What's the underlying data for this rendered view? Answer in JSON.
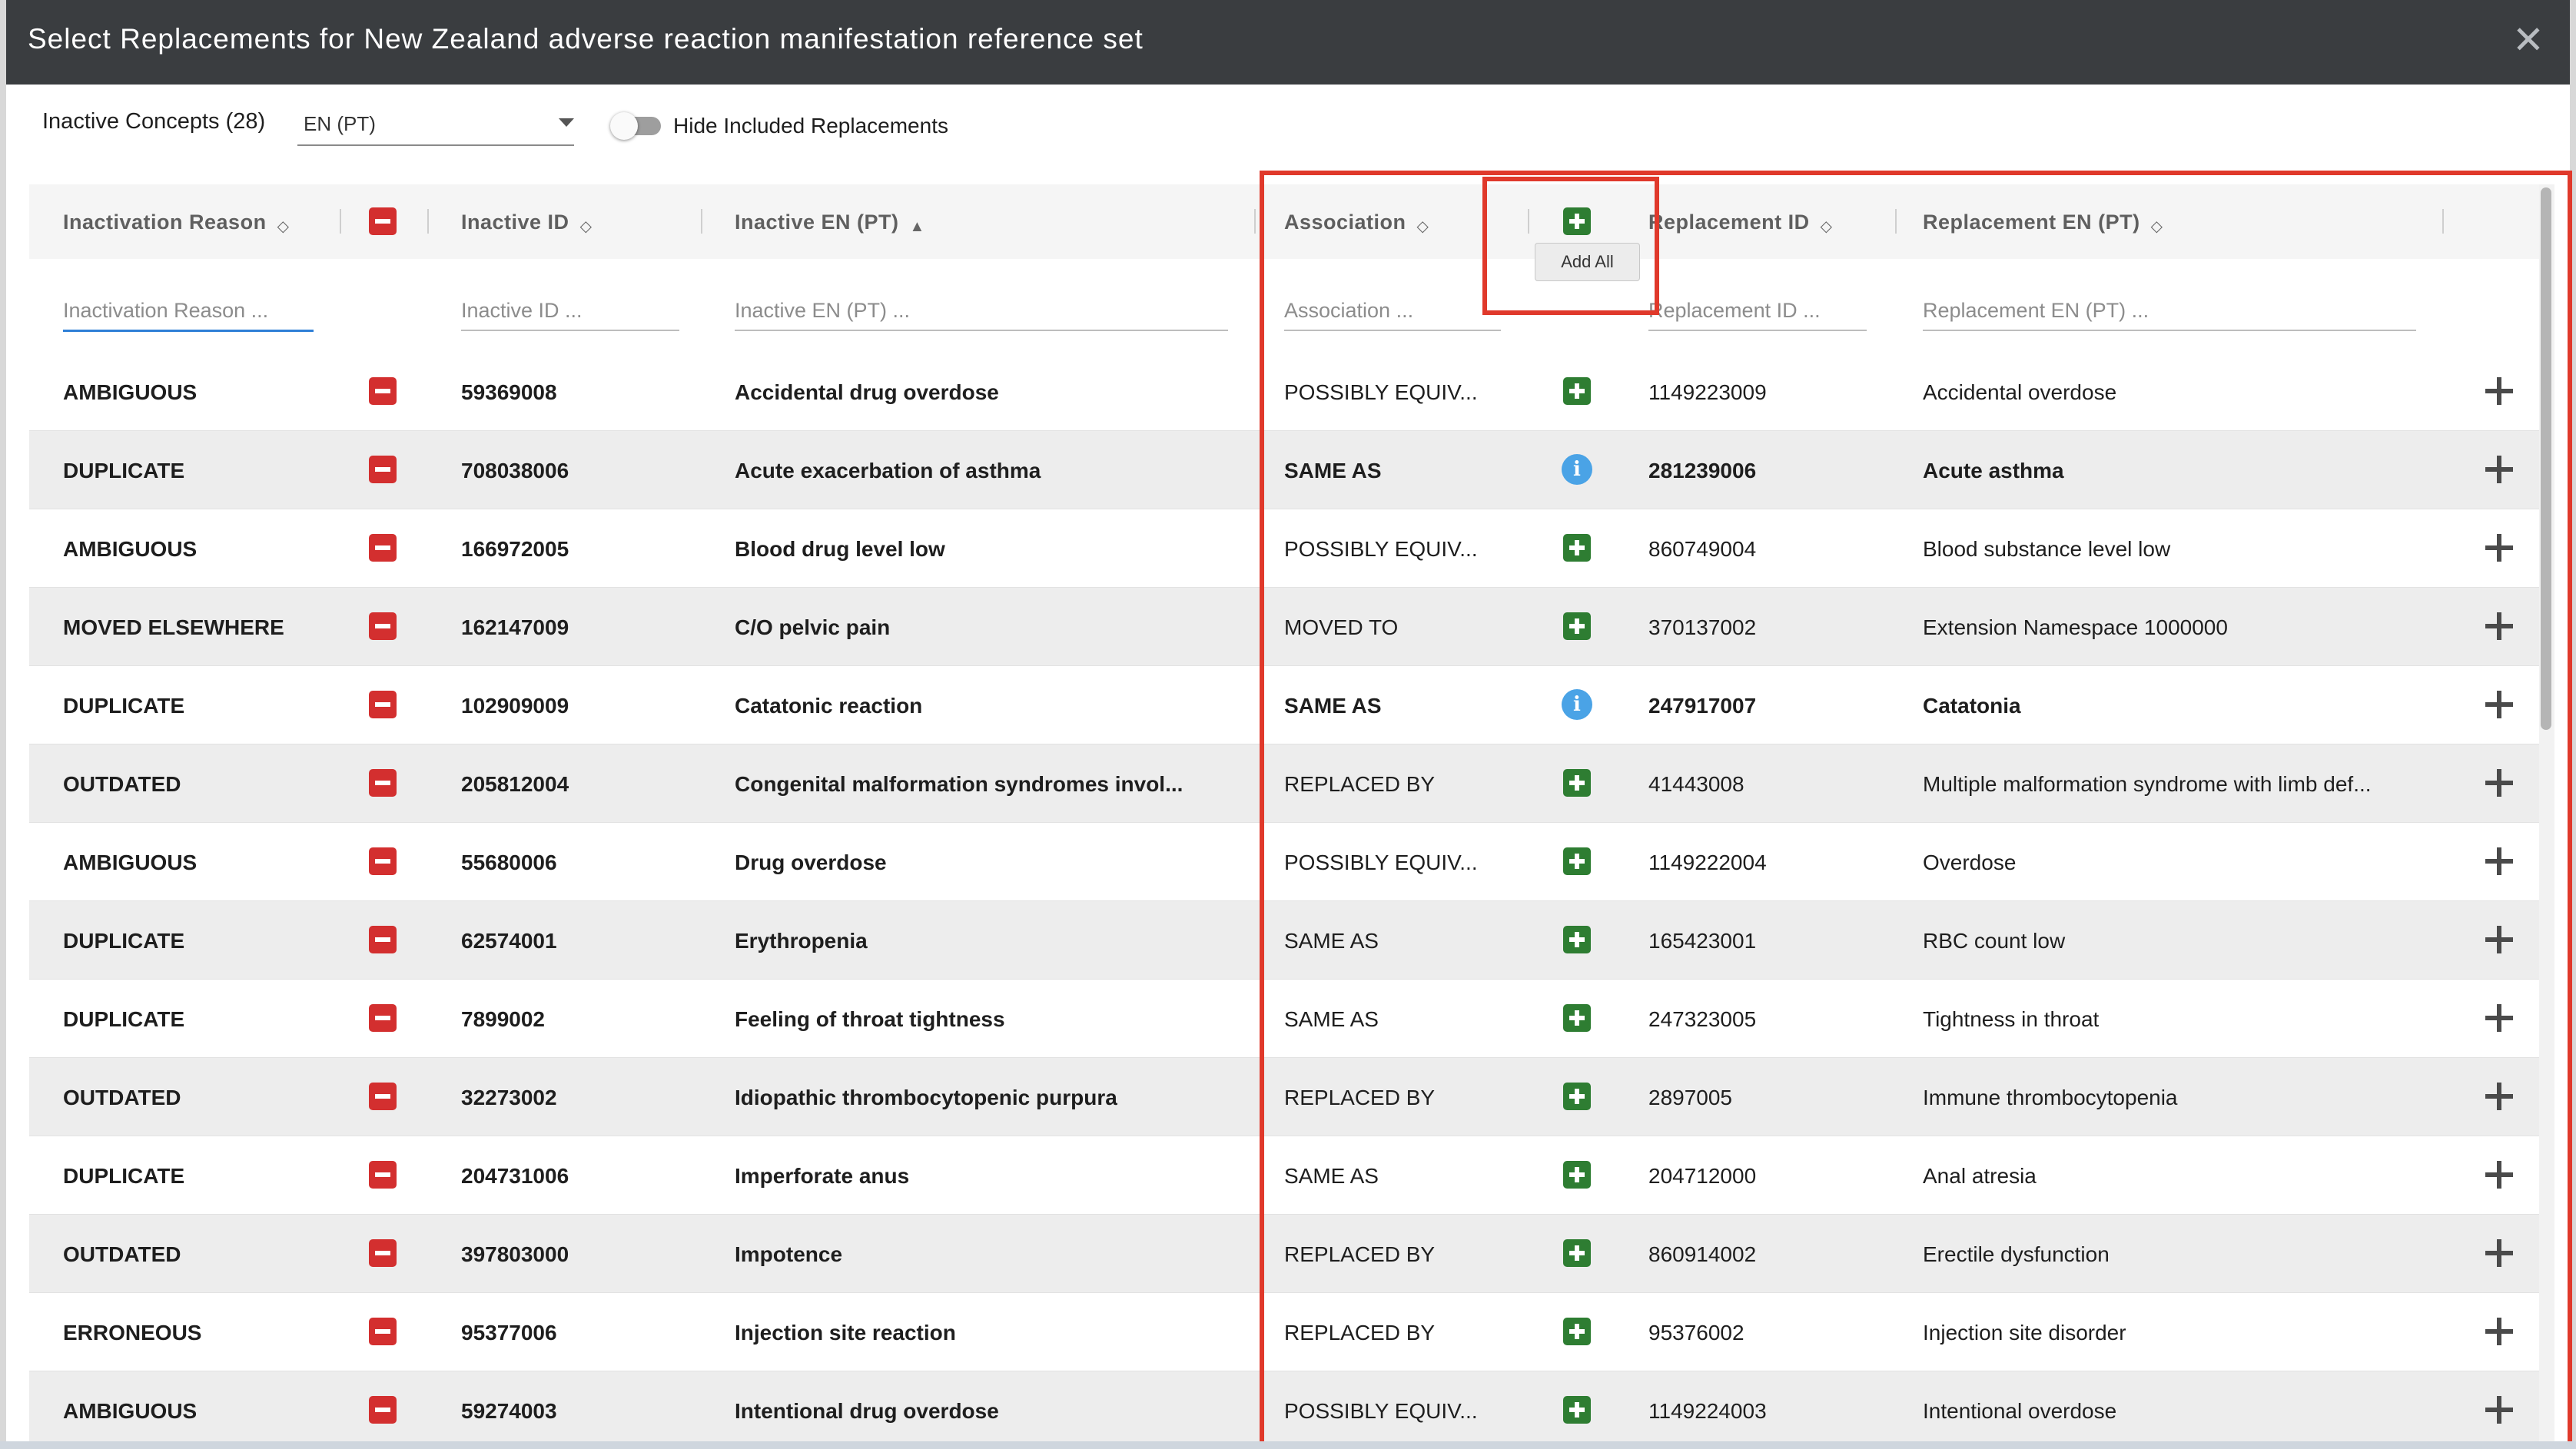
{
  "dialog": {
    "title": "Select Replacements for New Zealand adverse reaction manifestation reference set",
    "close_icon": "close-icon"
  },
  "toolbar": {
    "inactive_count_label": "Inactive Concepts (28)",
    "language_value": "EN (PT)",
    "hide_toggle_label": "Hide Included Replacements",
    "hide_toggle_on": false
  },
  "columns": {
    "inactivation_reason": "Inactivation Reason",
    "inactive_id": "Inactive ID",
    "inactive_en": "Inactive EN (PT)",
    "association": "Association",
    "replacement_id": "Replacement ID",
    "replacement_en": "Replacement EN (PT)"
  },
  "filters": {
    "inactivation_reason": "Inactivation Reason ...",
    "inactive_id": "Inactive ID ...",
    "inactive_en": "Inactive EN (PT) ...",
    "association": "Association ...",
    "replacement_id": "Replacement ID ...",
    "replacement_en": "Replacement EN (PT) ..."
  },
  "tooltip": {
    "add_all": "Add All"
  },
  "colors": {
    "remove": "#d32f2f",
    "add": "#2e7d32",
    "info": "#4aa3e6",
    "highlight": "#e0392b",
    "titlebar": "#3a3d40"
  },
  "rows": [
    {
      "reason": "AMBIGUOUS",
      "inactive_id": "59369008",
      "inactive_en": "Accidental drug overdose",
      "association": "POSSIBLY EQUIV...",
      "action": "add",
      "replacement_id": "1149223009",
      "replacement_en": "Accidental overdose",
      "included": false
    },
    {
      "reason": "DUPLICATE",
      "inactive_id": "708038006",
      "inactive_en": "Acute exacerbation of asthma",
      "association": "SAME AS",
      "action": "info",
      "replacement_id": "281239006",
      "replacement_en": "Acute asthma",
      "included": true
    },
    {
      "reason": "AMBIGUOUS",
      "inactive_id": "166972005",
      "inactive_en": "Blood drug level low",
      "association": "POSSIBLY EQUIV...",
      "action": "add",
      "replacement_id": "860749004",
      "replacement_en": "Blood substance level low",
      "included": false
    },
    {
      "reason": "MOVED ELSEWHERE",
      "inactive_id": "162147009",
      "inactive_en": "C/O pelvic pain",
      "association": "MOVED TO",
      "action": "add",
      "replacement_id": "370137002",
      "replacement_en": "Extension Namespace 1000000",
      "included": false
    },
    {
      "reason": "DUPLICATE",
      "inactive_id": "102909009",
      "inactive_en": "Catatonic reaction",
      "association": "SAME AS",
      "action": "info",
      "replacement_id": "247917007",
      "replacement_en": "Catatonia",
      "included": true
    },
    {
      "reason": "OUTDATED",
      "inactive_id": "205812004",
      "inactive_en": "Congenital malformation syndromes invol...",
      "association": "REPLACED BY",
      "action": "add",
      "replacement_id": "41443008",
      "replacement_en": "Multiple malformation syndrome with limb def...",
      "included": false
    },
    {
      "reason": "AMBIGUOUS",
      "inactive_id": "55680006",
      "inactive_en": "Drug overdose",
      "association": "POSSIBLY EQUIV...",
      "action": "add",
      "replacement_id": "1149222004",
      "replacement_en": "Overdose",
      "included": false
    },
    {
      "reason": "DUPLICATE",
      "inactive_id": "62574001",
      "inactive_en": "Erythropenia",
      "association": "SAME AS",
      "action": "add",
      "replacement_id": "165423001",
      "replacement_en": "RBC count low",
      "included": false
    },
    {
      "reason": "DUPLICATE",
      "inactive_id": "7899002",
      "inactive_en": "Feeling of throat tightness",
      "association": "SAME AS",
      "action": "add",
      "replacement_id": "247323005",
      "replacement_en": "Tightness in throat",
      "included": false
    },
    {
      "reason": "OUTDATED",
      "inactive_id": "32273002",
      "inactive_en": "Idiopathic thrombocytopenic purpura",
      "association": "REPLACED BY",
      "action": "add",
      "replacement_id": "2897005",
      "replacement_en": "Immune thrombocytopenia",
      "included": false
    },
    {
      "reason": "DUPLICATE",
      "inactive_id": "204731006",
      "inactive_en": "Imperforate anus",
      "association": "SAME AS",
      "action": "add",
      "replacement_id": "204712000",
      "replacement_en": "Anal atresia",
      "included": false
    },
    {
      "reason": "OUTDATED",
      "inactive_id": "397803000",
      "inactive_en": "Impotence",
      "association": "REPLACED BY",
      "action": "add",
      "replacement_id": "860914002",
      "replacement_en": "Erectile dysfunction",
      "included": false
    },
    {
      "reason": "ERRONEOUS",
      "inactive_id": "95377006",
      "inactive_en": "Injection site reaction",
      "association": "REPLACED BY",
      "action": "add",
      "replacement_id": "95376002",
      "replacement_en": "Injection site disorder",
      "included": false
    },
    {
      "reason": "AMBIGUOUS",
      "inactive_id": "59274003",
      "inactive_en": "Intentional drug overdose",
      "association": "POSSIBLY EQUIV...",
      "action": "add",
      "replacement_id": "1149224003",
      "replacement_en": "Intentional overdose",
      "included": false
    }
  ]
}
